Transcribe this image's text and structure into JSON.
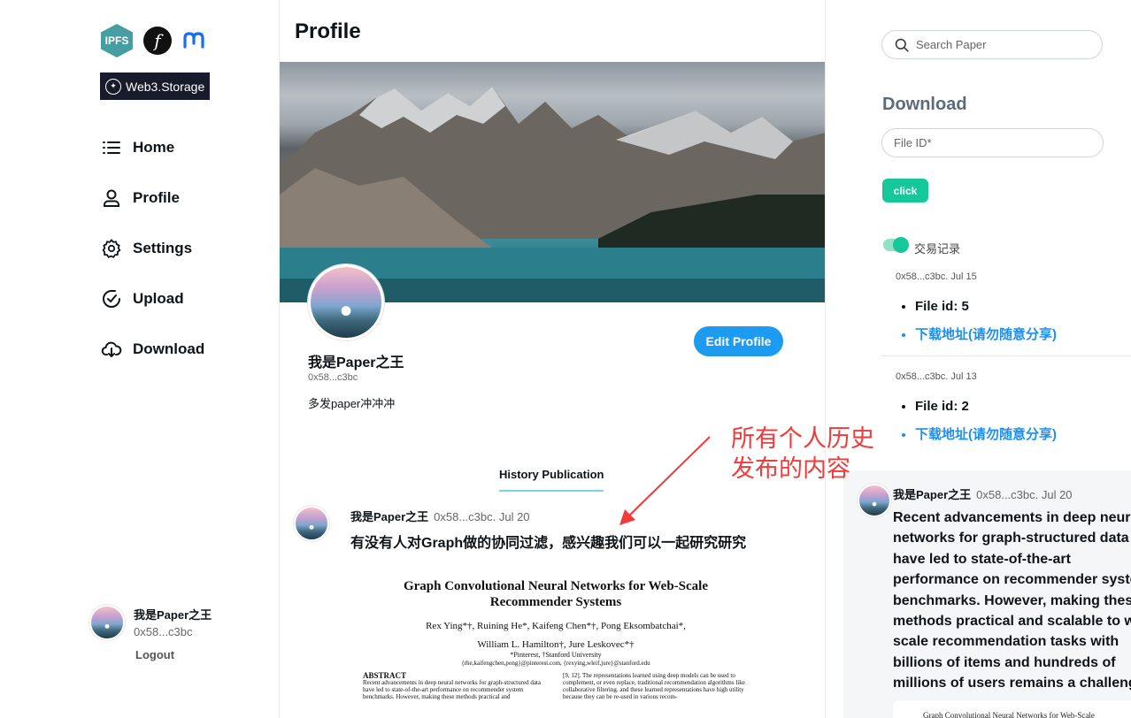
{
  "sidebar": {
    "logos": {
      "ipfs": "IPFS",
      "filecoin": "f",
      "web3storage": "Web3.Storage"
    },
    "nav": [
      {
        "label": "Home",
        "icon": "menu-icon"
      },
      {
        "label": "Profile",
        "icon": "user-icon"
      },
      {
        "label": "Settings",
        "icon": "gear-icon"
      },
      {
        "label": "Upload",
        "icon": "upload-icon"
      },
      {
        "label": "Download",
        "icon": "cloud-download-icon"
      }
    ],
    "account": {
      "name": "我是Paper之王",
      "address": "0x58...c3bc",
      "logout": "Logout"
    }
  },
  "main": {
    "title": "Profile",
    "profile": {
      "name": "我是Paper之王",
      "address": "0x58...c3bc",
      "bio": "多发paper冲冲冲",
      "edit_button": "Edit Profile"
    },
    "tab": "History Publication",
    "post": {
      "author": "我是Paper之王",
      "meta": "0x58...c3bc. Jul 20",
      "text": "有没有人对Graph做的协同过滤，感兴趣我们可以一起研究研究",
      "paper": {
        "title": "Graph Convolutional Neural Networks for Web-Scale Recommender Systems",
        "authors_line1": "Rex Ying*†, Ruining He*, Kaifeng Chen*†, Pong Eksombatchai*,",
        "authors_line2": "William L. Hamilton†, Jure Leskovec*†",
        "affiliation": "*Pinterest, †Stanford University",
        "emails": "{rhe,kaifengchen,pong}@pinterest.com, {rexying,wleif,jure}@stanford.edu",
        "abstract_heading": "ABSTRACT",
        "abstract_text": "Recent advancements in deep neural networks for graph-structured data have led to state-of-the-art performance on recommender system benchmarks. However, making these methods practical and",
        "right_col_text": "[9, 12]. The representations learned using deep models can be used to complement, or even replace, traditional recommendation algorithms like collaborative filtering. and these learned representations have high utility because they can be re-used in various recom-"
      }
    }
  },
  "annotation": {
    "line1": "所有个人历史",
    "line2": "发布的内容",
    "color": "#f23a3a"
  },
  "right": {
    "search_placeholder": "Search Paper",
    "download_title": "Download",
    "file_id_placeholder": "File ID*",
    "click_button": "click",
    "toggle_label": "交易记录",
    "records": [
      {
        "meta": "0x58...c3bc. Jul 15",
        "file_id": "File id: 5",
        "link": "下载地址(请勿随意分享)"
      },
      {
        "meta": "0x58...c3bc. Jul 13",
        "file_id": "File id: 2",
        "link": "下载地址(请勿随意分享)"
      }
    ],
    "feed_card": {
      "author": "我是Paper之王",
      "meta": "0x58...c3bc. Jul 20",
      "text": "Recent advancements in deep neural networks for graph-structured data have led to state-of-the-art performance on recommender system benchmarks. However, making these methods practical and scalable to web-scale recommendation tasks with billions of items and hundreds of millions of users remains a challenge.",
      "doc_preview": "Graph Convolutional Neural Networks for Web-Scale"
    }
  },
  "colors": {
    "accent": "#1d9bf0",
    "green": "#16c79a",
    "link": "#1d8ff0"
  }
}
